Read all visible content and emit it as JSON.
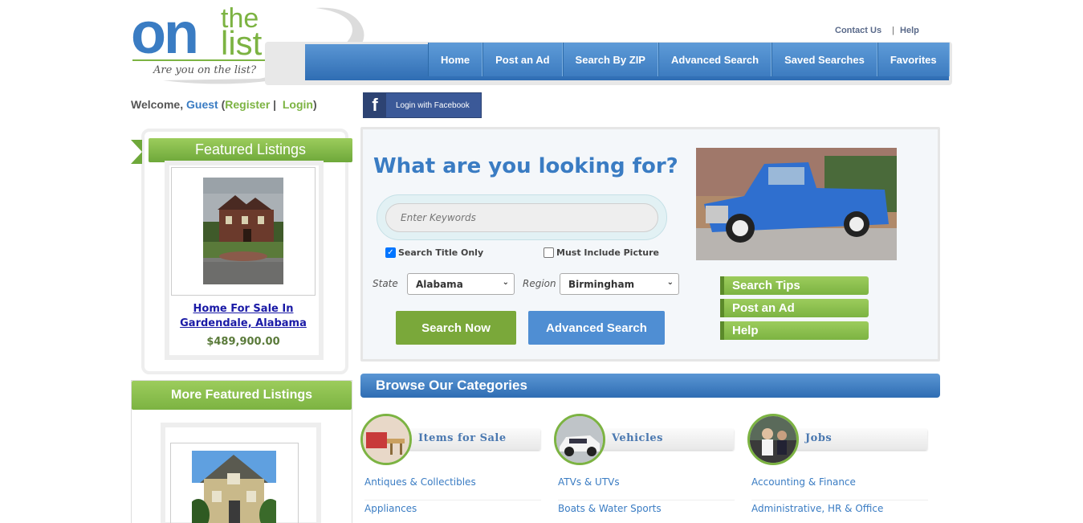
{
  "logo": {
    "on": "on",
    "the": "the",
    "list": "list",
    "tagline": "Are you on the list?"
  },
  "toplinks": {
    "contact": "Contact Us",
    "separator": "|",
    "help": "Help"
  },
  "nav": [
    "Home",
    "Post an Ad",
    "Search By ZIP",
    "Advanced Search",
    "Saved Searches",
    "Favorites"
  ],
  "welcome": {
    "prefix": "Welcome,",
    "user": "Guest",
    "open": "(",
    "register": "Register",
    "pipe": "|",
    "login": "Login",
    "close": ")"
  },
  "facebook": {
    "icon": "f",
    "label": "Login with Facebook"
  },
  "featured": {
    "heading": "Featured Listings",
    "title": "Home For Sale In Gardendale, Alabama",
    "price": "$489,900.00",
    "more_heading": "More Featured Listings"
  },
  "search": {
    "heading": "What are you looking for?",
    "keywords_placeholder": "Enter Keywords",
    "title_only": "Search Title Only",
    "must_picture": "Must Include Picture",
    "state_label": "State",
    "state_value": "Alabama",
    "region_label": "Region",
    "region_value": "Birmingham",
    "search_btn": "Search Now",
    "advanced_btn": "Advanced Search",
    "side_links": [
      "Search Tips",
      "Post an Ad",
      "Help"
    ]
  },
  "categories": {
    "heading": "Browse Our Categories",
    "columns": [
      {
        "name": "Items for Sale",
        "links": [
          "Antiques & Collectibles",
          "Appliances"
        ]
      },
      {
        "name": "Vehicles",
        "links": [
          "ATVs & UTVs",
          "Boats & Water Sports"
        ]
      },
      {
        "name": "Jobs",
        "links": [
          "Accounting & Finance",
          "Administrative, HR & Office"
        ]
      }
    ]
  },
  "colors": {
    "brand_blue": "#3a7cc3",
    "brand_green": "#7cb342",
    "nav_blue": "#4f8ed3"
  }
}
